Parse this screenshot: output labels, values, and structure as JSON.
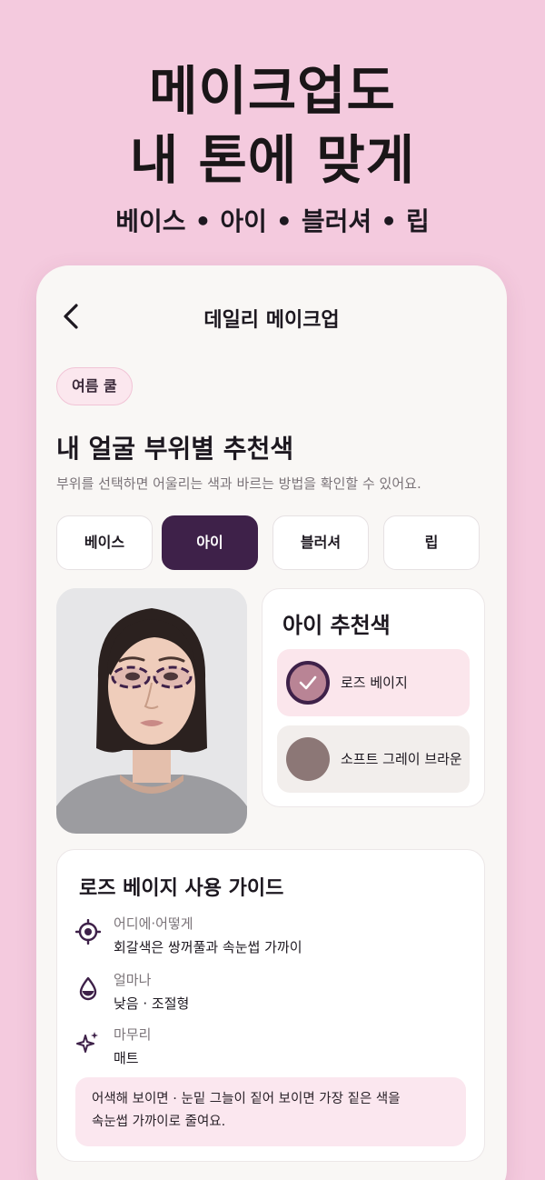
{
  "hero": {
    "title_line1": "메이크업도",
    "title_line2": "내 톤에 맞게",
    "categories": [
      "베이스",
      "아이",
      "블러셔",
      "립"
    ],
    "separator": "•"
  },
  "header": {
    "title": "데일리 메이크업",
    "back_icon": "chevron-left-icon"
  },
  "season_badge": "여름 쿨",
  "section": {
    "title": "내 얼굴 부위별 추천색",
    "description": "부위를 선택하면 어울리는 색과 바르는 방법을 확인할 수 있어요."
  },
  "tabs": [
    {
      "label": "베이스",
      "active": false
    },
    {
      "label": "아이",
      "active": true
    },
    {
      "label": "블러셔",
      "active": false
    },
    {
      "label": "립",
      "active": false
    }
  ],
  "recommendation": {
    "title": "아이 추천색",
    "options": [
      {
        "label": "로즈 베이지",
        "color": "#b98495",
        "selected": true
      },
      {
        "label": "소프트 그레이 브라운",
        "color": "#8c7776",
        "selected": false
      }
    ]
  },
  "guide": {
    "title": "로즈 베이지 사용 가이드",
    "rows": [
      {
        "icon": "target-icon",
        "label": "어디에·어떻게",
        "value": "회갈색은 쌍꺼풀과 속눈썹 가까이"
      },
      {
        "icon": "drop-icon",
        "label": "얼마나",
        "value": "낮음 · 조절형"
      },
      {
        "icon": "sparkle-icon",
        "label": "마무리",
        "value": "매트"
      }
    ],
    "tip_line1": "어색해 보이면 · 눈밑 그늘이 짙어 보이면 가장 짙은 색을",
    "tip_line2": "속눈썹 가까이로 줄여요."
  },
  "colors": {
    "accent": "#3e2149",
    "background": "#f4cade",
    "highlight": "#fbe6ec"
  }
}
